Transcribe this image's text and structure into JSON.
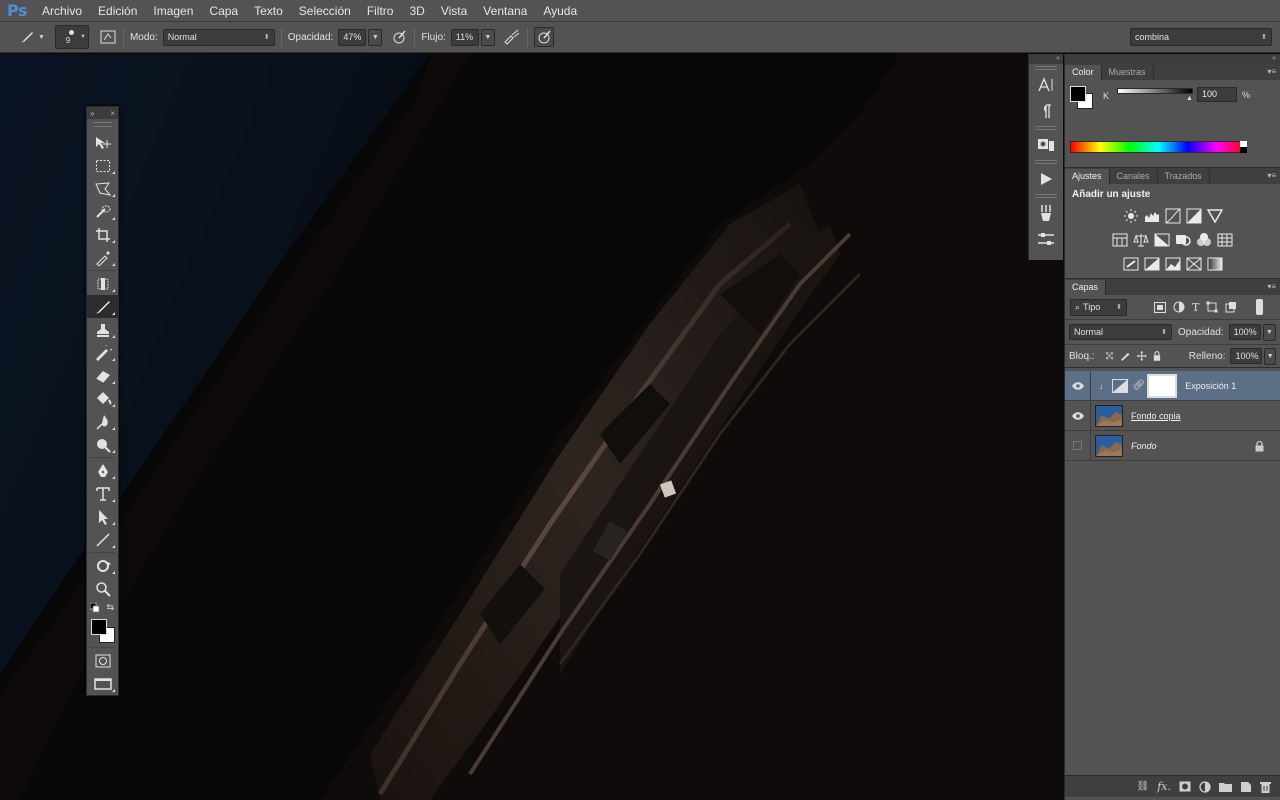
{
  "app": {
    "logo": "Ps"
  },
  "menu": [
    "Archivo",
    "Edición",
    "Imagen",
    "Capa",
    "Texto",
    "Selección",
    "Filtro",
    "3D",
    "Vista",
    "Ventana",
    "Ayuda"
  ],
  "options": {
    "brush_size": "9",
    "mode_label": "Modo:",
    "mode_value": "Normal",
    "opacity_label": "Opacidad:",
    "opacity_value": "47%",
    "flow_label": "Flujo:",
    "flow_value": "11%",
    "workspace": "combina"
  },
  "color_panel": {
    "tabs": [
      "Color",
      "Muestras"
    ],
    "channel": "K",
    "value": "100",
    "unit": "%"
  },
  "adjustments_panel": {
    "tabs": [
      "Ajustes",
      "Canales",
      "Trazados"
    ],
    "title": "Añadir un ajuste"
  },
  "layers_panel": {
    "tab": "Capas",
    "filter": "Tipo",
    "blend_mode": "Normal",
    "opacity_label": "Opacidad:",
    "opacity_value": "100%",
    "lock_label": "Bloq.:",
    "fill_label": "Relleno:",
    "fill_value": "100%",
    "layers": [
      {
        "name": "Exposición 1",
        "visible": true,
        "selected": true
      },
      {
        "name": "Fondo copia",
        "visible": true,
        "selected": false
      },
      {
        "name": "Fondo",
        "visible": false,
        "selected": false,
        "locked": true
      }
    ]
  },
  "colors": {
    "chrome": "#535353",
    "selection": "#5b6f87",
    "logo": "#4d8fd6"
  }
}
